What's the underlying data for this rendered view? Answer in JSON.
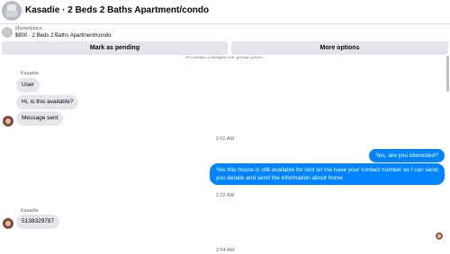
{
  "header": {
    "title": "Kasadie · 2 Beds 2 Baths Apartment/condo"
  },
  "marketplace": {
    "label": "Marketplace",
    "listing": "$800 · 2 Beds 2 Baths Apartment/condo"
  },
  "actions": {
    "pending_label": "Mark as pending",
    "more_label": "More options"
  },
  "conversation": {
    "system_notice": "A contact changed the group photo.",
    "first_group": {
      "sender": "Kasadie",
      "messages": [
        "User",
        "Hi, is this available?",
        "Message sent"
      ]
    },
    "timestamp_1": "2:01 AM",
    "outgoing": [
      "Yes, are you interested?",
      "Yes this house is still available for rent let me have your contact number so I can send",
      "you detaile and send the information about home"
    ],
    "timestamp_2": "2:22 AM",
    "second_group": {
      "sender": "Kasadie",
      "message": "5138329787"
    },
    "timestamp_3": "3:54 AM"
  }
}
